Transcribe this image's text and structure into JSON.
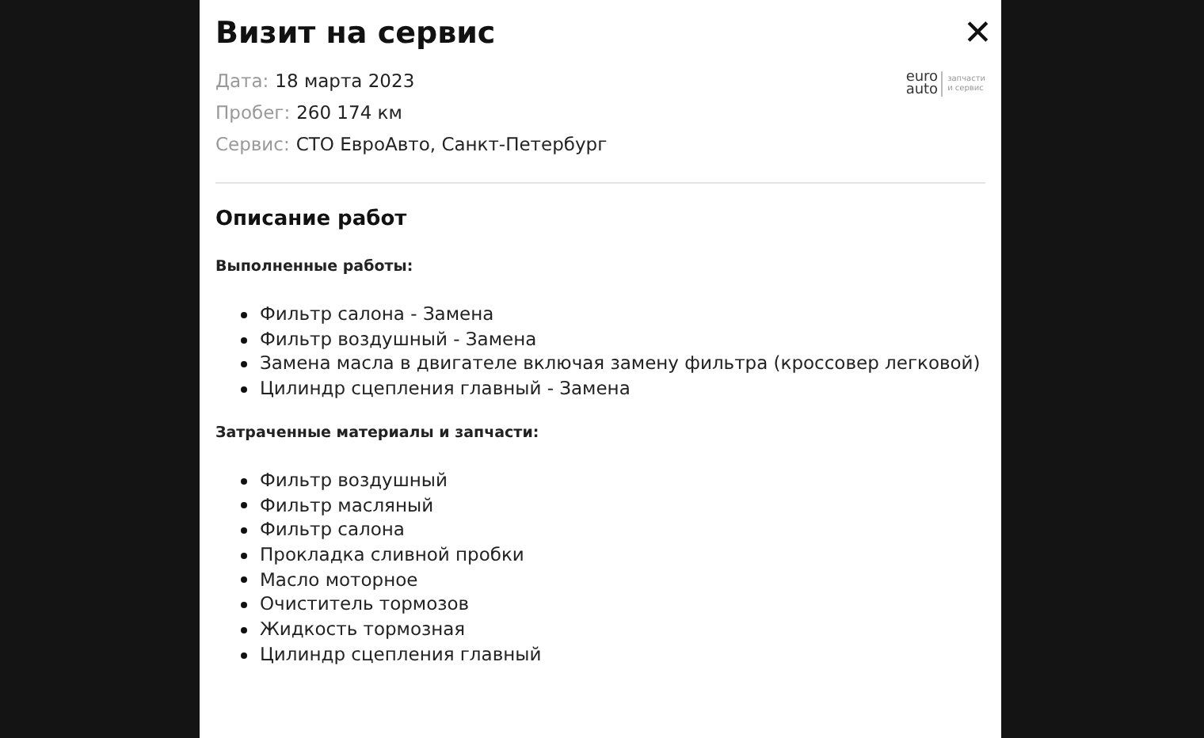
{
  "modal": {
    "title": "Визит на сервис",
    "close": "✕",
    "logo": {
      "top": "euro",
      "bottom": "auto",
      "tagline_1": "запчасти",
      "tagline_2": "и сервис"
    },
    "details": [
      {
        "label": "Дата:",
        "value": "18 марта 2023"
      },
      {
        "label": "Пробег:",
        "value": "260 174 км"
      },
      {
        "label": "Сервис:",
        "value": "СТО ЕвроАвто, Санкт-Петербург"
      }
    ],
    "section_title": "Описание работ",
    "groups": [
      {
        "heading": "Выполненные работы:",
        "items": [
          "Фильтр салона - Замена",
          "Фильтр воздушный - Замена",
          "Замена масла в двигателе включая замену фильтра (кроссовер легковой)",
          "Цилиндр сцепления главный - Замена"
        ]
      },
      {
        "heading": "Затраченные материалы и запчасти:",
        "items": [
          "Фильтр воздушный",
          "Фильтр масляный",
          "Фильтр салона",
          "Прокладка сливной пробки",
          "Масло моторное",
          "Очиститель тормозов",
          "Жидкость тормозная",
          "Цилиндр сцепления главный"
        ]
      }
    ]
  }
}
